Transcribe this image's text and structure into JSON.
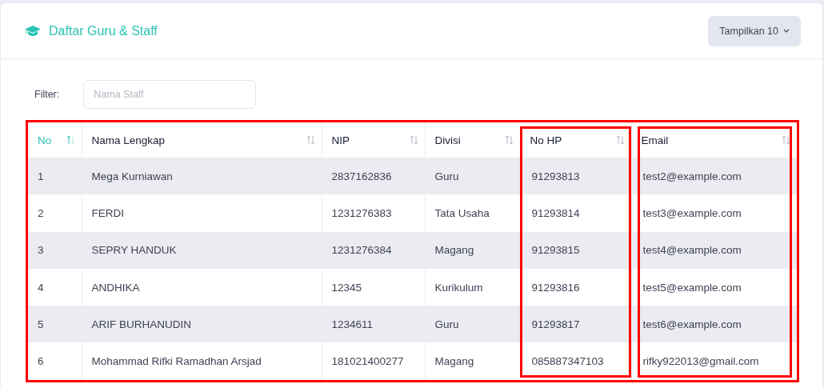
{
  "header": {
    "title": "Daftar Guru & Staff",
    "page_size_button": "Tampilkan 10"
  },
  "filter": {
    "label": "Filter:",
    "placeholder": "Nama Staff"
  },
  "table": {
    "highlighted": true,
    "columns": [
      {
        "label": "No",
        "sorted": true,
        "highlighted": false
      },
      {
        "label": "Nama Lengkap",
        "sorted": false,
        "highlighted": false
      },
      {
        "label": "NIP",
        "sorted": false,
        "highlighted": false
      },
      {
        "label": "Divisi",
        "sorted": false,
        "highlighted": false
      },
      {
        "label": "No HP",
        "sorted": false,
        "highlighted": true
      },
      {
        "label": "Email",
        "sorted": false,
        "highlighted": true
      }
    ],
    "rows": [
      [
        "1",
        "Mega Kurniawan",
        "2837162836",
        "Guru",
        "91293813",
        "test2@example.com"
      ],
      [
        "2",
        "FERDI",
        "1231276383",
        "Tata Usaha",
        "91293814",
        "test3@example.com"
      ],
      [
        "3",
        "SEPRY HANDUK",
        "1231276384",
        "Magang",
        "91293815",
        "test4@example.com"
      ],
      [
        "4",
        "ANDHIKA",
        "12345",
        "Kurikulum",
        "91293816",
        "test5@example.com"
      ],
      [
        "5",
        "ARIF BURHANUDIN",
        "1234611",
        "Guru",
        "91293817",
        "test6@example.com"
      ],
      [
        "6",
        "Mohammad Rifki Ramadhan Arsjad",
        "181021400277",
        "Magang",
        "085887347103",
        "rifky922013@gmail.com"
      ]
    ]
  }
}
